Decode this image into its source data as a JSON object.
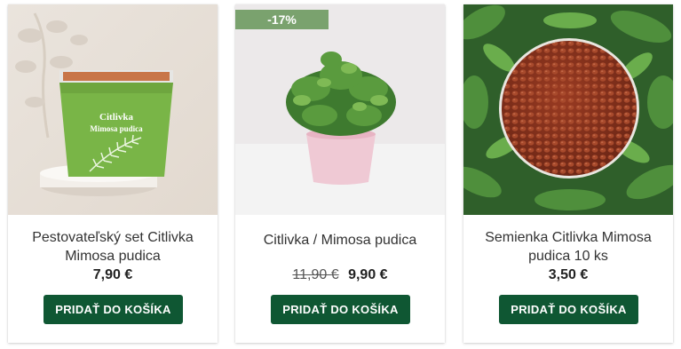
{
  "products": [
    {
      "title": "Pestovateľský set Citlivka Mimosa pudica",
      "price": "7,90 €",
      "button": "PRIDAŤ DO KOŠÍKA",
      "package_label_1": "Citlivka",
      "package_label_2": "Mimosa pudica"
    },
    {
      "badge": "-17%",
      "title": "Citlivka / Mimosa pudica",
      "old_price": "11,90 €",
      "price": "9,90 €",
      "button": "PRIDAŤ DO KOŠÍKA"
    },
    {
      "title": "Semienka Citlivka Mimosa pudica 10 ks",
      "price": "3,50 €",
      "button": "PRIDAŤ DO KOŠÍKA"
    }
  ],
  "colors": {
    "button_bg": "#0f5733",
    "badge_bg": "#7aa26e",
    "package_green": "#79b547"
  }
}
